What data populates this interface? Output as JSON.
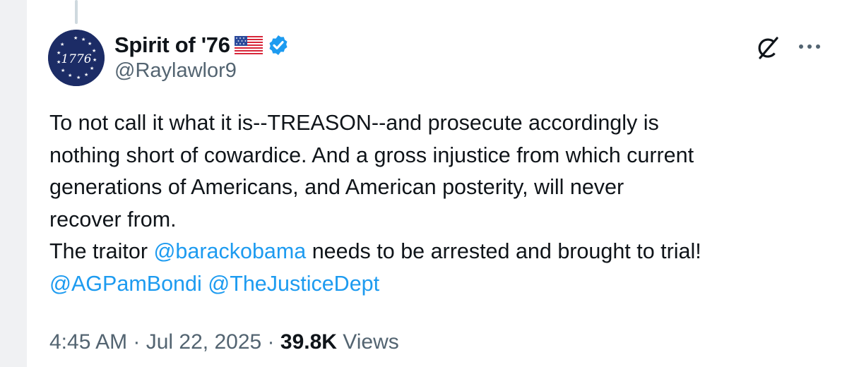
{
  "author": {
    "display_name": "Spirit of '76",
    "handle": "@Raylawlor9",
    "avatar_text": "1776",
    "name_emoji": "us-flag-icon",
    "verified": true,
    "verified_color": "#1d9bf0"
  },
  "tweet": {
    "line1": "To not call it what it is--TREASON--and prosecute accordingly is",
    "line2": "nothing short of cowardice. And a gross injustice from which current",
    "line3": "generations of Americans, and American posterity, will never",
    "line4": "recover from.",
    "line5_prefix": "The traitor ",
    "mention1": "@barackobama",
    "line5_suffix": " needs to be arrested and brought to trial!",
    "mention2": "@AGPamBondi",
    "mention3": "@TheJusticeDept"
  },
  "meta": {
    "time": "4:45 AM",
    "separator": " · ",
    "date": "Jul 22, 2025",
    "views_count": "39.8K",
    "views_label": " Views"
  },
  "icons": {
    "grok": "grok-icon",
    "more": "more-icon"
  },
  "colors": {
    "link": "#1d9bf0",
    "text": "#0f1419",
    "secondary": "#536471"
  }
}
